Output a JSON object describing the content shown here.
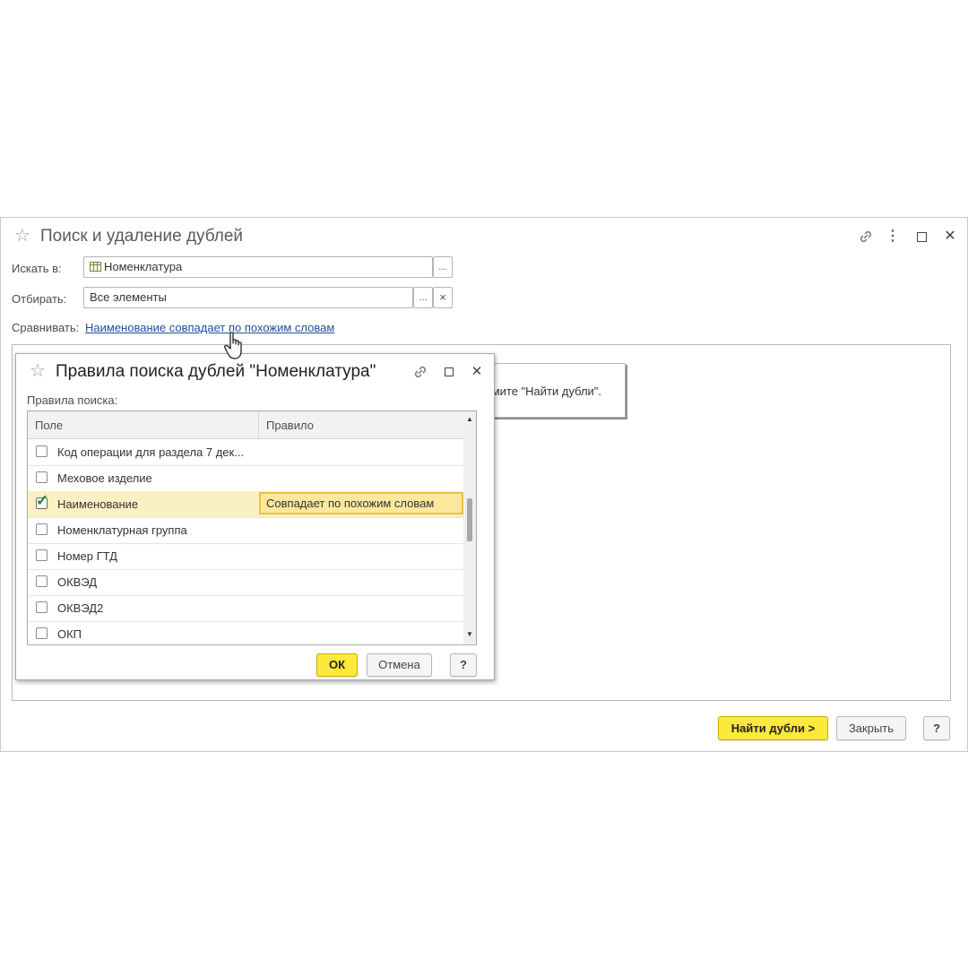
{
  "main": {
    "title": "Поиск и удаление дублей",
    "search_in_label": "Искать в:",
    "search_in_value": "Номенклатура",
    "filter_label": "Отбирать:",
    "filter_value": "Все элементы",
    "compare_label": "Сравнивать:",
    "compare_link": "Наименование совпадает по похожим словам",
    "hint_text": "жмите \"Найти дубли\".",
    "find_button": "Найти дубли >",
    "close_button": "Закрыть",
    "help_button": "?",
    "select_btn": "...",
    "clear_btn": "×"
  },
  "dialog": {
    "title": "Правила поиска дублей \"Номенклатура\"",
    "rules_label": "Правила поиска:",
    "columns": [
      "Поле",
      "Правило"
    ],
    "rows": [
      {
        "field": "Код операции для раздела 7 дек...",
        "checked": false,
        "rule": ""
      },
      {
        "field": "Меховое изделие",
        "checked": false,
        "rule": ""
      },
      {
        "field": "Наименование",
        "checked": true,
        "rule": "Совпадает по похожим словам"
      },
      {
        "field": "Номенклатурная группа",
        "checked": false,
        "rule": ""
      },
      {
        "field": "Номер ГТД",
        "checked": false,
        "rule": ""
      },
      {
        "field": "ОКВЭД",
        "checked": false,
        "rule": ""
      },
      {
        "field": "ОКВЭД2",
        "checked": false,
        "rule": ""
      },
      {
        "field": "ОКП",
        "checked": false,
        "rule": ""
      }
    ],
    "ok_button": "ОК",
    "cancel_button": "Отмена",
    "help_button": "?"
  },
  "icons": {
    "star": "☆",
    "link": "🔗",
    "more": "⋮",
    "maximize": "☐",
    "close": "✕",
    "scroll_up": "▲",
    "scroll_down": "▼"
  },
  "colors": {
    "accent": "#fde83c",
    "link": "#1f4f9a",
    "selection": "#fbf0c4"
  }
}
